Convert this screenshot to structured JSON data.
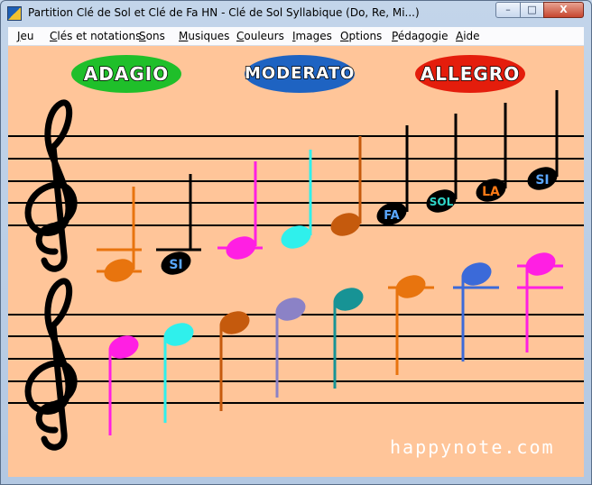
{
  "window": {
    "title": "Partition Clé de Sol et Clé de Fa HN - Clé de Sol Syllabique (Do, Re, Mi...)",
    "controls": [
      "–",
      "□",
      "X"
    ]
  },
  "menu": [
    "Jeu",
    "Clés et notations",
    "Sons",
    "Musiques",
    "Couleurs",
    "Images",
    "Options",
    "Pédagogie",
    "Aide"
  ],
  "tempo_buttons": {
    "adagio": "ADAGIO",
    "moderato": "MODERATO",
    "allegro": "ALLEGRO"
  },
  "colors": {
    "adagio": "#1fbf2a",
    "moderato": "#1e63c2",
    "allegro": "#e41d0c",
    "background": "#ffc599"
  },
  "upper_staff_labels": [
    "SI",
    "FA",
    "SOL",
    "LA",
    "SI"
  ],
  "brand": "happynote.com",
  "icons": [
    "treble-clef-icon",
    "treble-clef-icon"
  ]
}
